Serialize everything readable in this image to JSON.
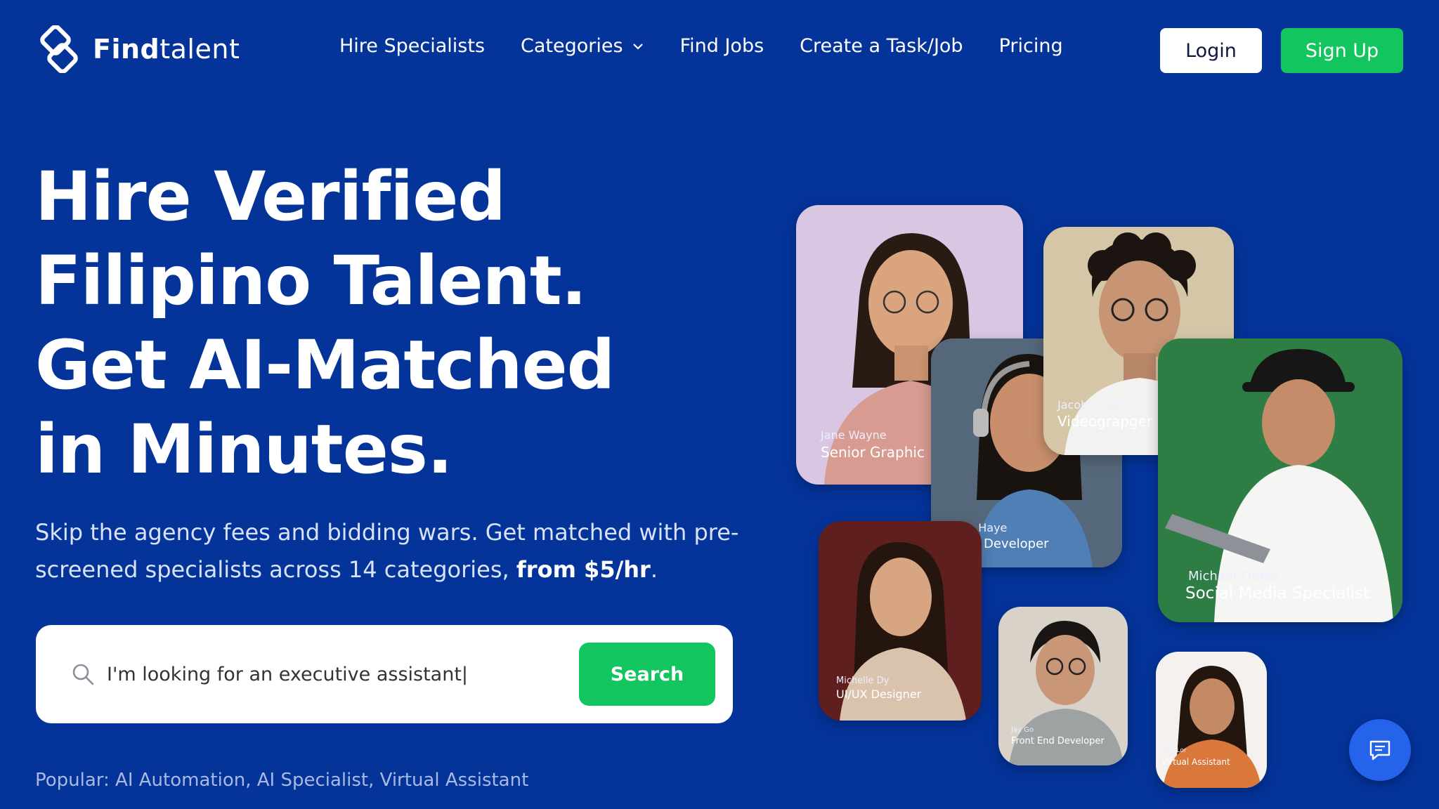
{
  "brand": {
    "name_bold": "Find",
    "name_rest": "talent",
    "accent": "#12c55e",
    "background": "#04339a"
  },
  "nav": {
    "items": [
      "Hire Specialists",
      "Categories",
      "Find Jobs",
      "Create a Task/Job",
      "Pricing"
    ],
    "login_label": "Login",
    "signup_label": "Sign Up"
  },
  "hero": {
    "headline_lines": [
      "Hire Verified",
      "Filipino Talent.",
      "Get AI-Matched",
      "in Minutes."
    ],
    "subtext": "Skip the agency fees and bidding wars. Get matched with pre-screened specialists across 14 categories, ",
    "subtext_bold": "from $5/hr",
    "subtext_end": "."
  },
  "search": {
    "value": "I'm looking for an executive assistant|",
    "button_label": "Search",
    "popular_text": "Popular: AI Automation, AI Specialist, Virtual Assistant"
  },
  "cards": [
    {
      "name": "Jane Wayne",
      "role": "Senior Graphic",
      "bg": "#d8c6e2"
    },
    {
      "name": "n Haye",
      "role": "Developer",
      "bg": "#6b7f95"
    },
    {
      "name": "Jacob Smith",
      "role": "Videograpger",
      "bg": "#d6c6a8"
    },
    {
      "name": "Michael Flores",
      "role": "Social Media Specialist",
      "bg": "#2e7d44"
    },
    {
      "name": "Michelle Dy",
      "role": "UI/UX Designer",
      "bg": "#5e1f1e"
    },
    {
      "name": "Jay Go",
      "role": "Front End Developer",
      "bg": "#d9d2c8"
    },
    {
      "name": "May Lor",
      "role": "Virtual Assistant",
      "bg": "#f4f1ee"
    }
  ]
}
